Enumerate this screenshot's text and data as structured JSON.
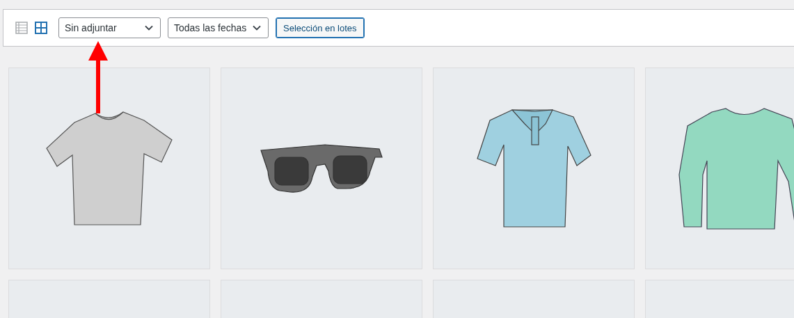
{
  "view_modes": [
    {
      "kind": "list",
      "selected": false
    },
    {
      "kind": "grid",
      "selected": true
    }
  ],
  "filters": [
    {
      "value": "Sin adjuntar"
    },
    {
      "value": "Todas las fechas"
    }
  ],
  "bulk_button": "Selección en lotes",
  "annotations": [
    {
      "kind": "arrow"
    }
  ],
  "attachments": [
    {
      "kind": "tshirt"
    },
    {
      "kind": "sunglasses"
    },
    {
      "kind": "polo"
    },
    {
      "kind": "longsleeve"
    },
    {
      "kind": "blank"
    },
    {
      "kind": "blank"
    },
    {
      "kind": "blank"
    },
    {
      "kind": "blank"
    }
  ]
}
